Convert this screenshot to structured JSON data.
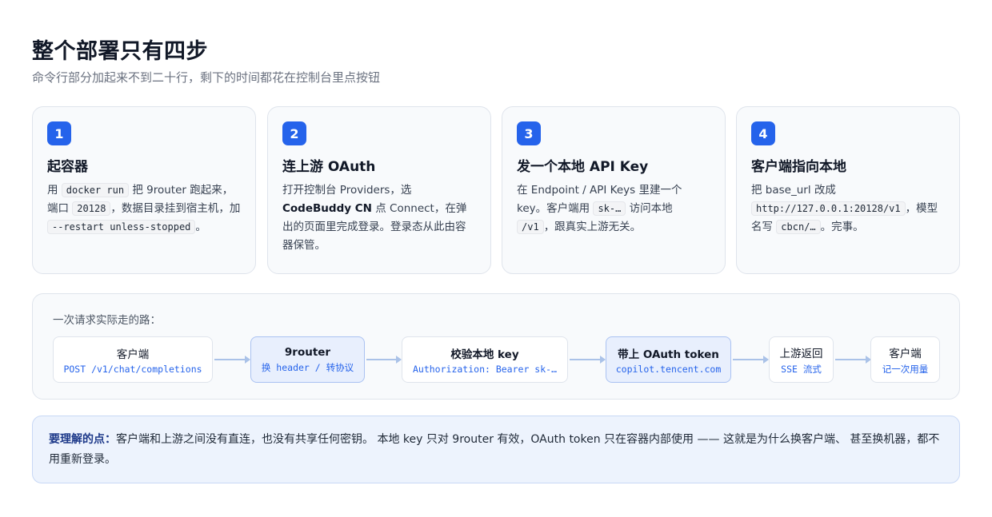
{
  "header": {
    "title": "整个部署只有四步",
    "subtitle": "命令行部分加起来不到二十行，剩下的时间都花在控制台里点按钮"
  },
  "steps": [
    {
      "number": "1",
      "title": "起容器",
      "t1": "用 ",
      "c1": "docker run",
      "t2": " 把 9router 跑起来，端口 ",
      "c2": "20128",
      "t3": "，数据目录挂到宿主机，加 ",
      "c3": "--restart unless-stopped",
      "t4": "。"
    },
    {
      "number": "2",
      "title": "连上游 OAuth",
      "t1": "打开控制台 Providers，选 ",
      "s1": "CodeBuddy CN",
      "t2": " 点 Connect，在弹出的页面里完成登录。登录态从此由容器保管。"
    },
    {
      "number": "3",
      "title": "发一个本地 API Key",
      "t1": "在 Endpoint / API Keys 里建一个 key。客户端用 ",
      "c1": "sk-…",
      "t2": " 访问本地 ",
      "c2": "/v1",
      "t3": "，跟真实上游无关。"
    },
    {
      "number": "4",
      "title": "客户端指向本地",
      "t1": "把 base_url 改成 ",
      "c1": "http://127.0.0.1:20128/v1",
      "t2": "，模型名写 ",
      "c2": "cbcn/…",
      "t3": "。完事。"
    }
  ],
  "flow": {
    "label": "一次请求实际走的路：",
    "nodes": [
      {
        "title": "客户端",
        "sub": "POST /v1/chat/completions"
      },
      {
        "title": "9router",
        "sub": "换 header / 转协议"
      },
      {
        "title": "校验本地 key",
        "sub": "Authorization: Bearer sk-…"
      },
      {
        "title": "带上 OAuth token",
        "sub": "copilot.tencent.com"
      },
      {
        "title": "上游返回",
        "sub": "SSE 流式"
      },
      {
        "title": "客户端",
        "sub": "记一次用量"
      }
    ]
  },
  "note": {
    "lead": "要理解的点：",
    "text": "客户端和上游之间没有直连，也没有共享任何密钥。 本地 key 只对 9router 有效，OAuth token 只在容器内部使用 —— 这就是为什么换客户端、 甚至换机器，都不用重新登录。"
  },
  "colors": {
    "accent": "#2563eb",
    "card_bg": "#f8fafc",
    "highlight_bg": "#e8effd",
    "note_bg": "#edf3fd"
  }
}
